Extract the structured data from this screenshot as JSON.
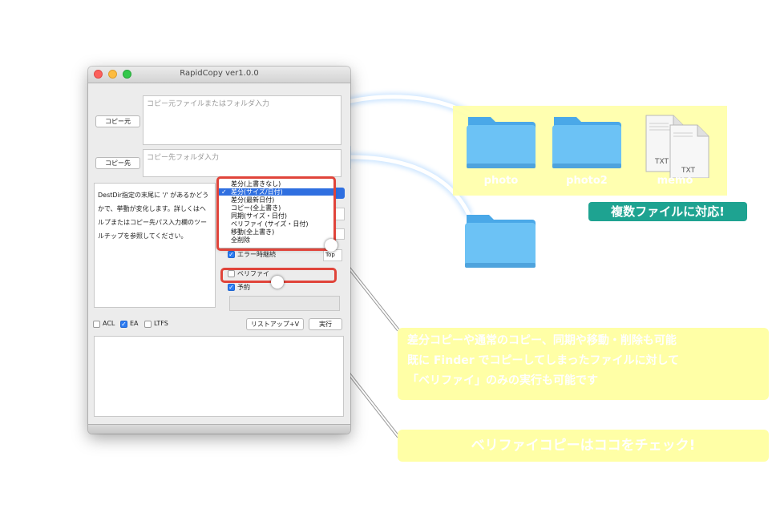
{
  "window": {
    "title": "RapidCopy ver1.0.0",
    "source_button": "コピー元",
    "source_placeholder": "コピー元ファイルまたはフォルダ入力",
    "dest_button": "コピー先",
    "dest_placeholder": "コピー先フォルダ入力",
    "description": "DestDir指定の末尾に '/' があるかどうかで、挙動が変化します。詳しくはヘルプまたはコピー先パス入力欄のツールチップを参照してください。",
    "mode_menu": {
      "items": [
        "差分(上書きなし)",
        "差分(サイズ/日付)",
        "差分(最新日付)",
        "コピー(全上書き)",
        "同期(サイズ・日付)",
        "ベリファイ (サイズ・日付)",
        "移動(全上書き)",
        "全削除"
      ],
      "selected": "差分(サイズ/日付)"
    },
    "error_checkbox": "エラー時継続",
    "top_field": "Top",
    "verify_checkbox": "ベリファイ",
    "dryrun_checkbox": "予約",
    "acl_label": "ACL",
    "ea_label": "EA",
    "ltfs_label": "LTFS",
    "listup_button": "リストアップ+V",
    "execute_button": "実行"
  },
  "promo": {
    "folders": [
      "photo",
      "photo2",
      "memo"
    ],
    "file_type_a": "TXT",
    "file_type_b": "TXT",
    "multi_badge": "複数ファイルに対応!",
    "feature_lines": [
      "差分コピーや通常のコピー、同期や移動・削除も可能",
      "既に Finder でコピーしてしまったファイルに対して",
      "「ベリファイ」のみの実行も可能です"
    ],
    "verify_banner": "ベリファイコピーはココをチェック!"
  },
  "colors": {
    "highlight_red": "#e0443a",
    "selection_blue": "#2f6fe0",
    "banner_yellow": "#ffffa6",
    "badge_teal": "#1ea391",
    "folder_blue": "#6cc2f5"
  }
}
